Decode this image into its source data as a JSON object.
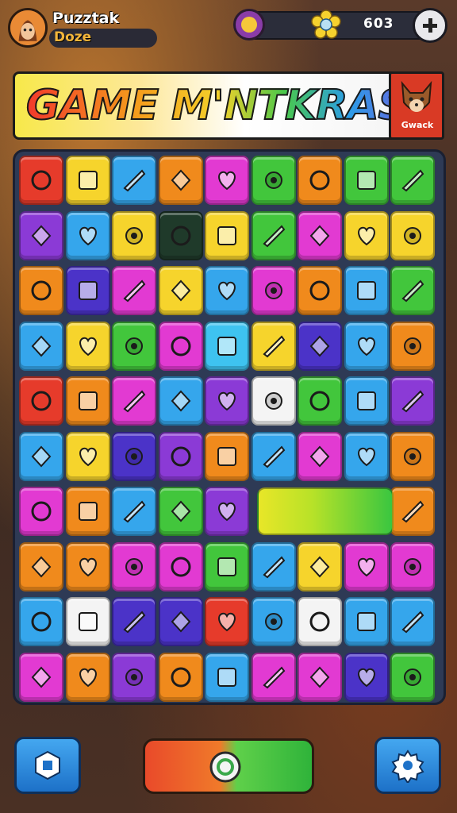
{
  "header": {
    "player_name": "Puzztak",
    "player_level_label": "Doze",
    "coins": "603",
    "add_coins_icon": "plus-icon"
  },
  "banner": {
    "title": "GAME M'NTKRASIN",
    "badge_label": "Gwack"
  },
  "board": {
    "rows": 10,
    "cols": 9,
    "tiles": [
      [
        "red-sq",
        "yellow-sq",
        "blue-sq",
        "orange-sq",
        "magenta-sq",
        "green-sq",
        "orange-sq",
        "green-sq",
        "green-sq"
      ],
      [
        "purple-sq",
        "blue-sq",
        "yellow-sq",
        "darkgreen-sq",
        "yellow-sq",
        "green-sq",
        "magenta-sq",
        "yellow-sq",
        "yellow-sq"
      ],
      [
        "orange-sq",
        "indigo-sq",
        "magenta-sq",
        "yellow-sq",
        "blue-sq",
        "magenta-sq",
        "orange-sq",
        "blue-sq",
        "green-sq"
      ],
      [
        "blue-sq",
        "yellow-sq",
        "green-sq",
        "magenta-sq",
        "cyan-sq",
        "yellow-sq",
        "indigo-sq",
        "blue-sq",
        "orange-sq"
      ],
      [
        "red-sq",
        "orange-sq",
        "magenta-sq",
        "blue-sq",
        "purple-sq",
        "white-sq",
        "green-sq",
        "blue-sq",
        "purple-sq"
      ],
      [
        "blue-sq",
        "yellow-sq",
        "indigo-sq",
        "purple-sq",
        "orange-sq",
        "blue-sq",
        "magenta-sq",
        "blue-sq",
        "orange-sq"
      ],
      [
        "magenta-sq",
        "orange-sq",
        "blue-sq",
        "green-sq",
        "purple-sq",
        "wide",
        "wide",
        "wide",
        "orange-sq"
      ],
      [
        "orange-sq",
        "orange-sq",
        "magenta-sq",
        "magenta-sq",
        "green-sq",
        "blue-sq",
        "yellow-sq",
        "magenta-sq",
        "magenta-sq"
      ],
      [
        "blue-sq",
        "white-sq",
        "indigo-sq",
        "indigo-sq",
        "red-sq",
        "blue-sq",
        "white-sq",
        "blue-sq",
        "blue-sq"
      ],
      [
        "magenta-sq",
        "orange-sq",
        "purple-sq",
        "orange-sq",
        "blue-sq",
        "magenta-sq",
        "magenta-sq",
        "indigo-sq",
        "green-sq"
      ]
    ],
    "colors": {
      "red-sq": "#e63b2b",
      "yellow-sq": "#f6d42c",
      "blue-sq": "#35a6ec",
      "orange-sq": "#f08a1c",
      "magenta-sq": "#e23ad2",
      "green-sq": "#42c63c",
      "purple-sq": "#8b3ad6",
      "darkgreen-sq": "#1f3a2a",
      "indigo-sq": "#4b33c8",
      "cyan-sq": "#3ec3f0",
      "white-sq": "#f4f4f4"
    }
  },
  "footer": {
    "left_button_icon": "hexagon-icon",
    "play_icon": "ring-icon",
    "right_button_icon": "gear-icon"
  }
}
